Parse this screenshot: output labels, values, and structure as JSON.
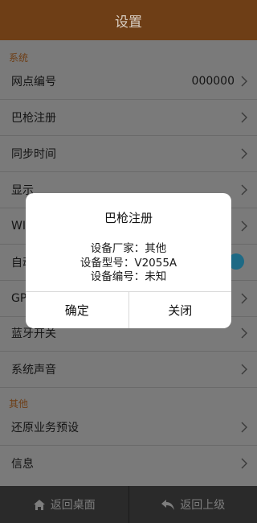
{
  "header": {
    "title": "设置"
  },
  "sections": [
    {
      "label": "系统"
    },
    {
      "label": "其他"
    }
  ],
  "rows": [
    {
      "label": "网点编号",
      "value": "000000"
    },
    {
      "label": "巴枪注册"
    },
    {
      "label": "同步时间"
    },
    {
      "label": "显示"
    },
    {
      "label": "WI"
    },
    {
      "label": "自动"
    },
    {
      "label": "GP"
    },
    {
      "label": "蓝牙开关"
    },
    {
      "label": "系统声音"
    },
    {
      "label": "还原业务预设"
    },
    {
      "label": "信息"
    }
  ],
  "dialog": {
    "title": "巴枪注册",
    "lines": [
      "设备厂家：其他",
      "设备型号：V2055A",
      "设备编号：未知"
    ],
    "confirm": "确定",
    "close": "关闭"
  },
  "bottom": {
    "home": "返回桌面",
    "back": "返回上级"
  },
  "colors": {
    "header": "#6e3e16",
    "accent": "#6e3e16",
    "toggle": "#1e6a85"
  },
  "icons": [
    "chevron-right-icon",
    "home-icon",
    "back-arrow-icon"
  ]
}
